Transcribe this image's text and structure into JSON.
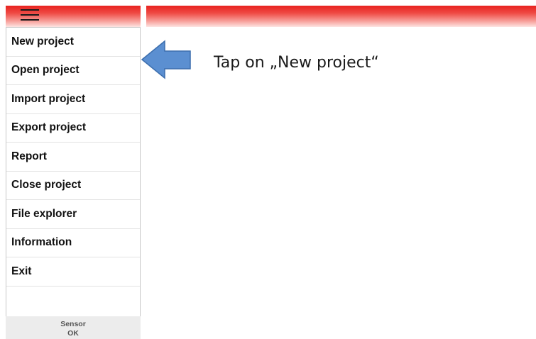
{
  "menu": {
    "items": [
      {
        "label": "New project"
      },
      {
        "label": "Open project"
      },
      {
        "label": "Import project"
      },
      {
        "label": "Export project"
      },
      {
        "label": "Report"
      },
      {
        "label": "Close project"
      },
      {
        "label": "File explorer"
      },
      {
        "label": "Information"
      },
      {
        "label": "Exit"
      }
    ],
    "toggle_icon": "hamburger-menu-icon"
  },
  "status": {
    "sensor_label": "Sensor",
    "sensor_value": "OK"
  },
  "annotation": {
    "instruction": "Tap on „New project“",
    "arrow_icon": "left-arrow-icon",
    "arrow_color": "#5b8fd1"
  },
  "colors": {
    "header_red": "#e8231f"
  }
}
